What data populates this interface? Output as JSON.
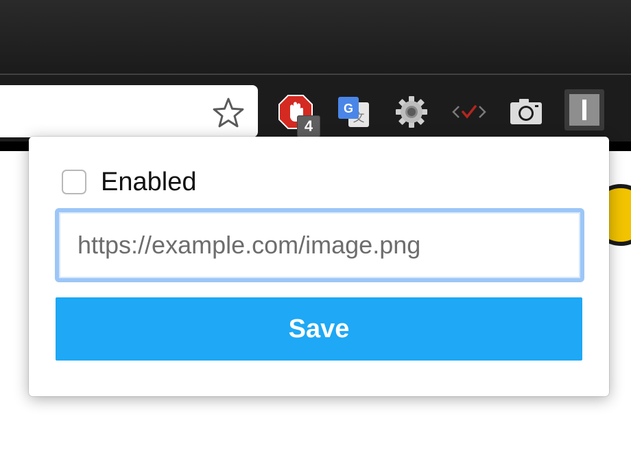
{
  "toolbar": {
    "bookmark_icon": "star-icon",
    "extensions": [
      {
        "name": "adblock-icon",
        "badge": "4"
      },
      {
        "name": "google-translate-icon"
      },
      {
        "name": "settings-gear-icon"
      },
      {
        "name": "code-check-icon"
      },
      {
        "name": "camera-icon"
      },
      {
        "name": "custom-extension-icon"
      }
    ]
  },
  "popup": {
    "enabled_label": "Enabled",
    "enabled_checked": false,
    "url_placeholder": "https://example.com/image.png",
    "url_value": "",
    "save_label": "Save"
  },
  "colors": {
    "save_button": "#1ea8f5",
    "input_focus_border": "#9cc6f7",
    "adblock_red": "#d42a22"
  }
}
